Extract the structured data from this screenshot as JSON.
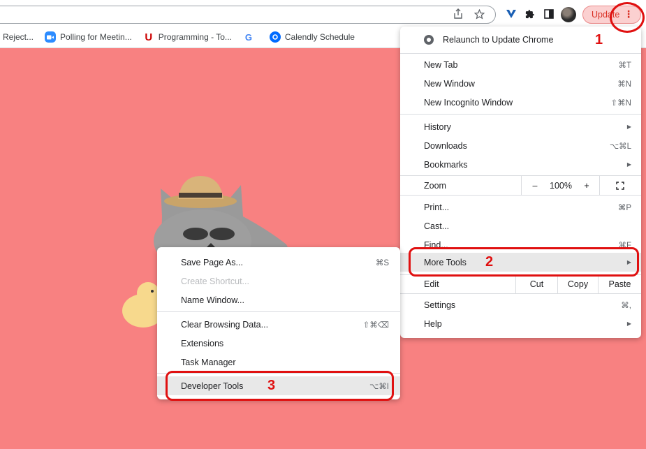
{
  "toolbar": {
    "update_label": "Update",
    "icons": [
      "share-icon",
      "star-icon",
      "vpn-extension-icon",
      "extensions-puzzle-icon",
      "side-panel-icon",
      "avatar",
      "kebab-menu-icon"
    ]
  },
  "bookmarks": [
    {
      "label": "Reject...",
      "icon": "none"
    },
    {
      "label": "Polling for Meetin...",
      "icon": "zoom-icon"
    },
    {
      "label": "Programming - To...",
      "icon": "utah-u-icon"
    },
    {
      "label": "",
      "icon": "google-g-icon"
    },
    {
      "label": "Calendly Schedule",
      "icon": "calendly-icon"
    }
  ],
  "chrome_menu": {
    "relaunch": "Relaunch to Update Chrome",
    "new_tab": {
      "label": "New Tab",
      "shortcut": "⌘T"
    },
    "new_window": {
      "label": "New Window",
      "shortcut": "⌘N"
    },
    "new_incognito": {
      "label": "New Incognito Window",
      "shortcut": "⇧⌘N"
    },
    "history": {
      "label": "History"
    },
    "downloads": {
      "label": "Downloads",
      "shortcut": "⌥⌘L"
    },
    "bookmarks": {
      "label": "Bookmarks"
    },
    "zoom": {
      "label": "Zoom",
      "minus": "–",
      "value": "100%",
      "plus": "+"
    },
    "print": {
      "label": "Print...",
      "shortcut": "⌘P"
    },
    "cast": {
      "label": "Cast..."
    },
    "find": {
      "label": "Find...",
      "shortcut": "⌘F"
    },
    "more_tools": {
      "label": "More Tools"
    },
    "edit": {
      "label": "Edit",
      "cut": "Cut",
      "copy": "Copy",
      "paste": "Paste"
    },
    "settings": {
      "label": "Settings",
      "shortcut": "⌘,"
    },
    "help": {
      "label": "Help"
    }
  },
  "more_tools_menu": {
    "save_page": {
      "label": "Save Page As...",
      "shortcut": "⌘S"
    },
    "create_shortcut": {
      "label": "Create Shortcut..."
    },
    "name_window": {
      "label": "Name Window..."
    },
    "clear_browsing": {
      "label": "Clear Browsing Data...",
      "shortcut": "⇧⌘⌫"
    },
    "extensions": {
      "label": "Extensions"
    },
    "task_manager": {
      "label": "Task Manager"
    },
    "developer_tools": {
      "label": "Developer Tools",
      "shortcut": "⌥⌘I"
    }
  },
  "annotations": {
    "step1": "1",
    "step2": "2",
    "step3": "3"
  },
  "colors": {
    "page_bg": "#f88181",
    "annotation": "#e01010",
    "update_text": "#d93025"
  }
}
